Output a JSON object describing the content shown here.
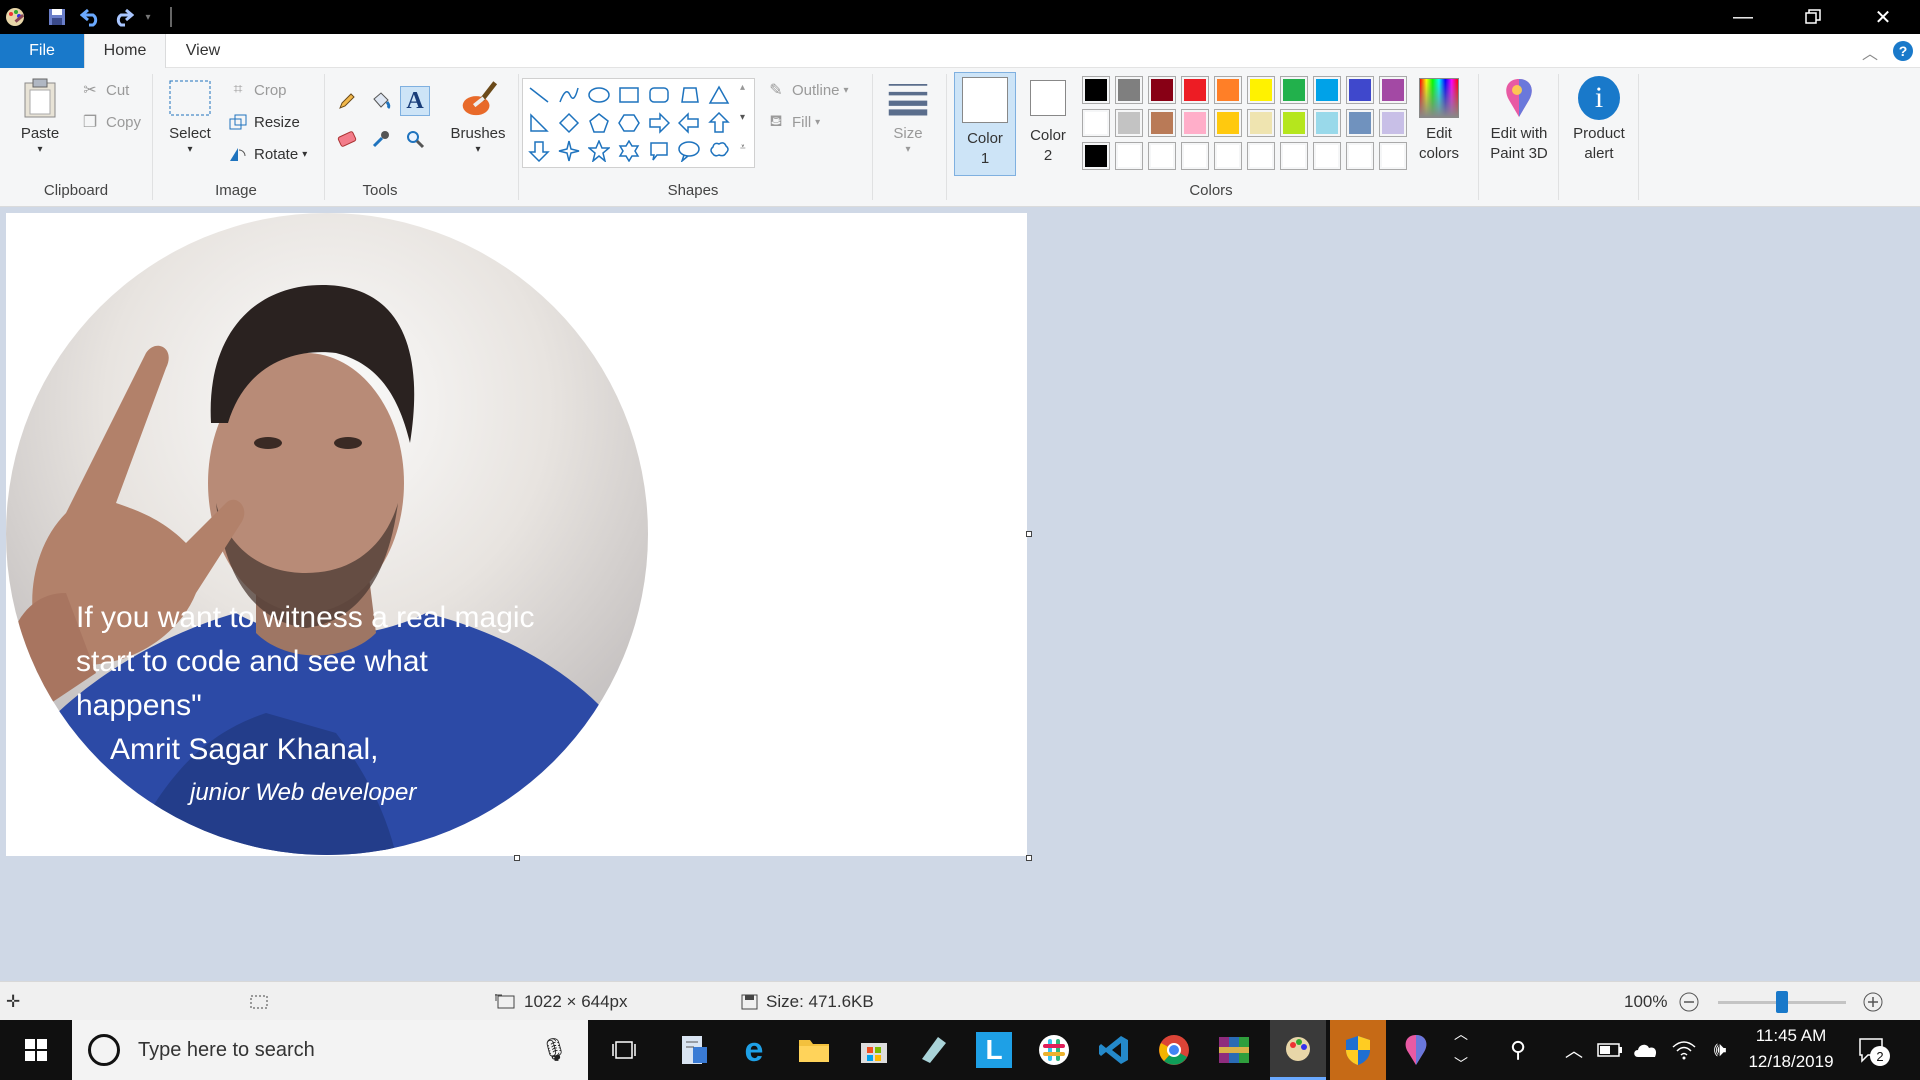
{
  "ribbon_tabs": [
    "File",
    "Home",
    "View"
  ],
  "clipboard": {
    "paste": "Paste",
    "cut": "Cut",
    "copy": "Copy",
    "label": "Clipboard"
  },
  "image": {
    "select": "Select",
    "crop": "Crop",
    "resize": "Resize",
    "rotate": "Rotate",
    "label": "Image"
  },
  "tools": {
    "label": "Tools",
    "brushes": "Brushes"
  },
  "shapes": {
    "outline": "Outline",
    "fill": "Fill",
    "label": "Shapes",
    "size": "Size"
  },
  "colors": {
    "color1": "Color 1",
    "color1_a": "Color",
    "color1_b": "1",
    "color2_a": "Color",
    "color2_b": "2",
    "edit_a": "Edit",
    "edit_b": "colors",
    "paint3d_a": "Edit with",
    "paint3d_b": "Paint 3D",
    "alert_a": "Product",
    "alert_b": "alert",
    "label": "Colors",
    "palette_row1": [
      "#000000",
      "#7f7f7f",
      "#880015",
      "#ed1c24",
      "#ff7f27",
      "#fff200",
      "#22b14c",
      "#00a2e8",
      "#3f48cc",
      "#a349a4"
    ],
    "palette_row2": [
      "#ffffff",
      "#c3c3c3",
      "#b97a57",
      "#ffaec9",
      "#ffc90e",
      "#efe4b0",
      "#b5e61d",
      "#99d9ea",
      "#7092be",
      "#c8bfe7"
    ],
    "palette_row3": [
      "#000000",
      "#ffffff",
      "#ffffff",
      "#ffffff",
      "#ffffff",
      "#ffffff",
      "#ffffff",
      "#ffffff",
      "#ffffff",
      "#ffffff"
    ]
  },
  "canvas": {
    "quote_line1": "If you want to witness a real magic",
    "quote_line2": "start to code and see what",
    "quote_line3": "happens\"",
    "author": "Amrit Sagar Khanal,",
    "role": "junior Web developer"
  },
  "status": {
    "dimensions": "1022 × 644px",
    "size": "Size: 471.6KB",
    "zoom": "100%"
  },
  "taskbar": {
    "search_placeholder": "Type here to search",
    "time": "11:45 AM",
    "date": "12/18/2019",
    "notifications": "2"
  }
}
